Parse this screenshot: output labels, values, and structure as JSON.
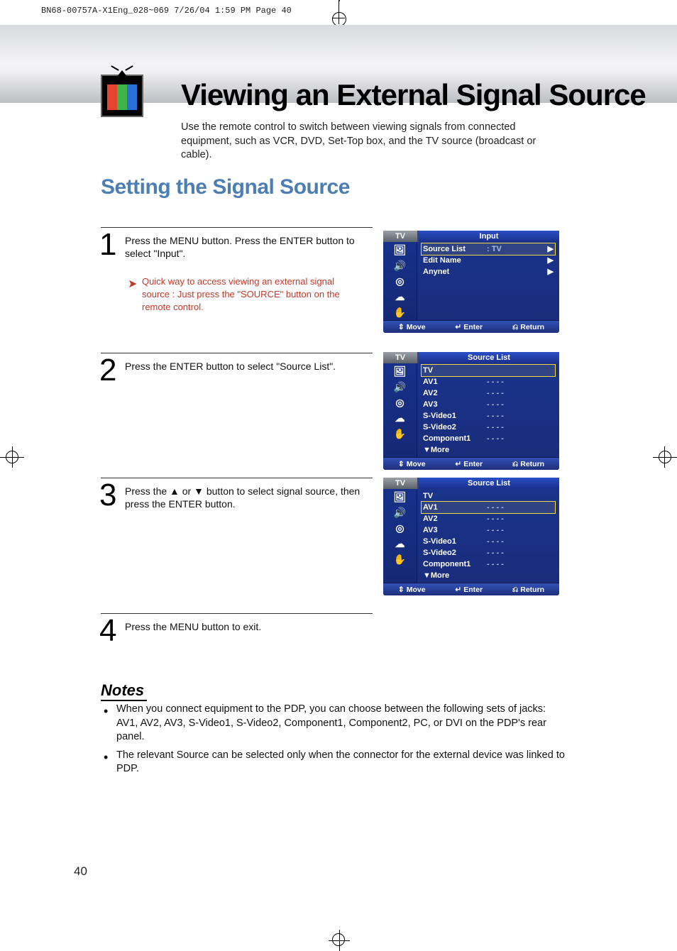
{
  "print_header": "BN68-00757A-X1Eng_028~069  7/26/04  1:59 PM  Page 40",
  "main_title": "Viewing an External Signal Source",
  "intro": "Use the remote control to switch between viewing signals from connected equipment, such as VCR, DVD, Set-Top box, and the TV source (broadcast or cable).",
  "section_title": "Setting the Signal Source",
  "steps": {
    "s1": {
      "num": "1",
      "text": "Press the MENU button. Press the ENTER button to select \"Input\"."
    },
    "s1_note": "Quick way to access viewing an external signal source : Just press the \"SOURCE\" button on the remote control.",
    "s2": {
      "num": "2",
      "text": "Press the ENTER button to select \"Source List\"."
    },
    "s3": {
      "num": "3",
      "text": "Press the ▲ or ▼ button to select signal source, then press the ENTER button."
    },
    "s4": {
      "num": "4",
      "text": "Press the MENU button to exit."
    }
  },
  "osd_common": {
    "tab_left": "TV",
    "footer": {
      "move": "Move",
      "enter": "Enter",
      "return": "Return"
    }
  },
  "osd1": {
    "title": "Input",
    "rows": [
      {
        "label": "Source List",
        "val": ":  TV",
        "arrow": "▶",
        "selected": true
      },
      {
        "label": "Edit Name",
        "val": "",
        "arrow": "▶",
        "selected": false
      },
      {
        "label": "Anynet",
        "val": "",
        "arrow": "▶",
        "selected": false
      }
    ]
  },
  "osd2": {
    "title": "Source List",
    "rows": [
      {
        "label": "TV",
        "val": "",
        "selected": true
      },
      {
        "label": "AV1",
        "val": "- - - -"
      },
      {
        "label": "AV2",
        "val": "- - - -"
      },
      {
        "label": "AV3",
        "val": "- - - -"
      },
      {
        "label": "S-Video1",
        "val": "- - - -"
      },
      {
        "label": "S-Video2",
        "val": "- - - -"
      },
      {
        "label": "Component1",
        "val": "- - - -"
      },
      {
        "label": "▼More",
        "val": ""
      }
    ]
  },
  "osd3": {
    "title": "Source List",
    "rows": [
      {
        "label": "TV",
        "val": ""
      },
      {
        "label": "AV1",
        "val": "- - - -",
        "selected": true
      },
      {
        "label": "AV2",
        "val": "- - - -"
      },
      {
        "label": "AV3",
        "val": "- - - -"
      },
      {
        "label": "S-Video1",
        "val": "- - - -"
      },
      {
        "label": "S-Video2",
        "val": "- - - -"
      },
      {
        "label": "Component1",
        "val": "- - - -"
      },
      {
        "label": "▼More",
        "val": ""
      }
    ]
  },
  "notes_heading": "Notes",
  "notes": [
    "When you connect equipment to the PDP, you can choose between the following sets of jacks: AV1, AV2, AV3, S-Video1, S-Video2, Component1, Component2, PC, or DVI on the PDP's rear panel.",
    "The relevant Source can be selected only when the connector for the external device was linked to PDP."
  ],
  "page_number": "40"
}
